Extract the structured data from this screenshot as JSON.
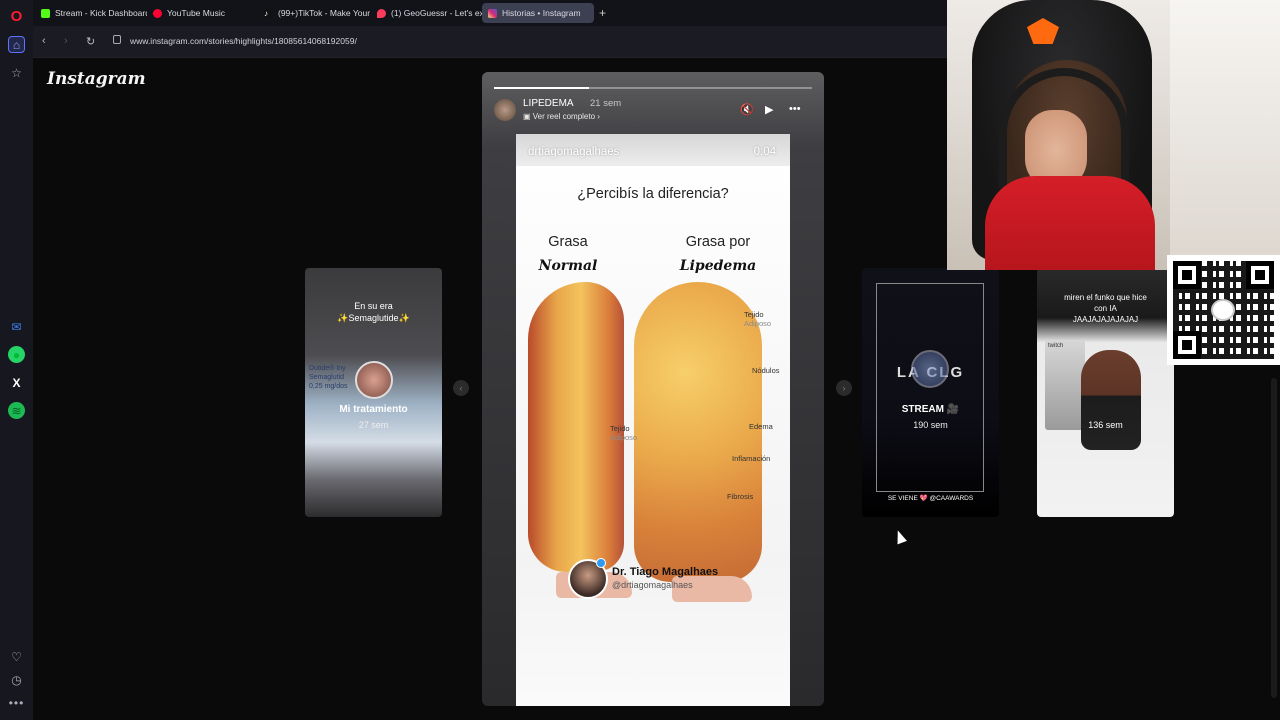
{
  "browser": {
    "tabs": [
      {
        "label": "Stream - Kick Dashboard",
        "color": "#53fc18"
      },
      {
        "label": "YouTube Music",
        "color": "#ff0033"
      },
      {
        "label": "(99+)TikTok - Make Your D",
        "color": "#111111"
      },
      {
        "label": "(1) GeoGuessr - Let's explo",
        "color": "#ff3b5c"
      },
      {
        "label": "Historias • Instagram",
        "color": "#e1306c"
      }
    ],
    "active_tab_index": 4,
    "url": "www.instagram.com/stories/highlights/18085614068192059/"
  },
  "sidebar": {
    "icons": [
      "opera-logo",
      "home-icon",
      "star-icon",
      "messenger-icon",
      "whatsapp-icon",
      "x-icon",
      "spotify-icon",
      "heart-icon",
      "clock-icon",
      "more-icon"
    ]
  },
  "instagram": {
    "logo": "Instagram",
    "story": {
      "username": "LIPEDEMA",
      "time": "21 sem",
      "reel_link": "Ver reel completo",
      "progress": 0.3,
      "content": {
        "handle": "drtiagomagalhaes",
        "duration": "0:04",
        "question": "¿Percibís la diferencia?",
        "left_label_1": "Grasa",
        "left_label_2": "Normal",
        "right_label_1": "Grasa por",
        "right_label_2": "Lipedema",
        "labels": {
          "tejido_adiposo_right_1": "Tejido",
          "tejido_adiposo_right_2": "Adiposo",
          "nodulos": "Nódulos",
          "edema": "Edema",
          "inflamacion": "Inflamación",
          "fibrosis": "Fibrosis",
          "tejido_adiposo_left_1": "Tejido",
          "tejido_adiposo_left_2": "Adiposo"
        },
        "doctor_name": "Dr. Tiago Magalhaes",
        "doctor_handle": "@drtiagomagalhaes"
      }
    },
    "prev_card": {
      "top_text_1": "En su era",
      "top_text_2": "✨Semaglutide✨",
      "box_text_1": "Dutide® Iny",
      "box_text_2": "Semaglutid",
      "box_text_3": "0,25 mg/dos",
      "title": "Mi tratamiento",
      "sub": "27 sem"
    },
    "next_card_1": {
      "logo_text": "LA CLG",
      "title": "STREAM 🎥",
      "sub": "190 sem",
      "footer": "SE VIENE 💖 @CAAWARDS"
    },
    "next_card_2": {
      "top_text_1": "miren el funko que hice",
      "top_text_2": "con IA",
      "top_text_3": "JAAJAJAJAJAJAJ",
      "box_label": "twitch",
      "sub": "136 sem"
    }
  }
}
